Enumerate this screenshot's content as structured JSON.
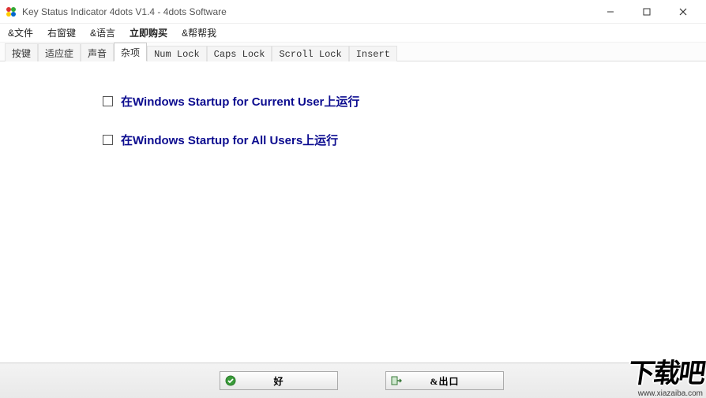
{
  "window": {
    "title": "Key Status Indicator 4dots V1.4 - 4dots Software"
  },
  "menu": {
    "file": "&文件",
    "right_window_key": "右窗键",
    "language": "&语言",
    "buy_now": "立即购买",
    "help": "&帮帮我"
  },
  "tabs": {
    "keys": "按键",
    "adaptive": "适应症",
    "sound": "声音",
    "misc": "杂项",
    "numlock": "Num Lock",
    "capslock": "Caps Lock",
    "scrolllock": "Scroll Lock",
    "insert": "Insert",
    "active": "misc"
  },
  "options": {
    "startup_current_user": "在Windows Startup for Current User上运行",
    "startup_all_users": "在Windows Startup for All Users上运行"
  },
  "buttons": {
    "ok": "好",
    "exit": "&出口"
  },
  "watermark": {
    "text": "下载吧",
    "url": "www.xiazaiba.com"
  }
}
